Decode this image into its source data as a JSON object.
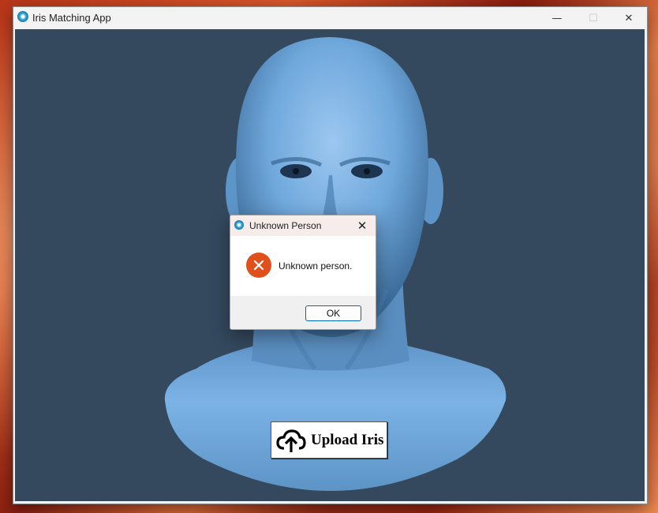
{
  "window": {
    "title": "Iris Matching App",
    "controls": {
      "minimize": "—",
      "maximize": "☐",
      "close": "✕"
    }
  },
  "main": {
    "upload_button_label": "Upload Iris"
  },
  "dialog": {
    "title": "Unknown Person",
    "message": "Unknown person.",
    "ok_label": "OK",
    "close_glyph": "✕"
  },
  "colors": {
    "client_background": "#34495e",
    "bust": "#6fa8dc",
    "error_icon": "#e0501c",
    "ok_border": "#0067c0"
  },
  "icons": {
    "app": "app-logo-icon",
    "error": "error-icon",
    "upload": "cloud-upload-icon"
  }
}
